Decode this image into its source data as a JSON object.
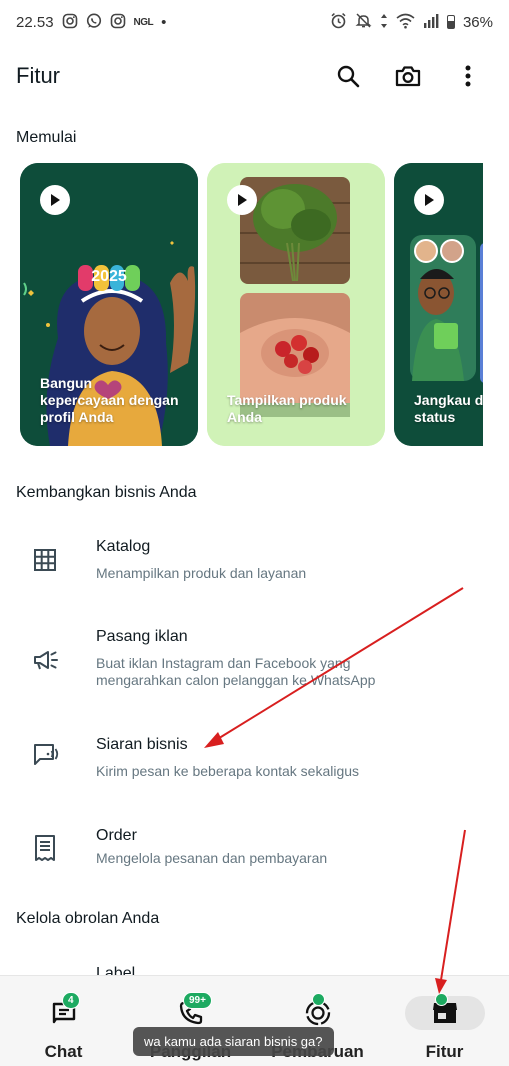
{
  "status_bar": {
    "time": "22.53",
    "ngl_label": "NGL",
    "dot": "•",
    "battery": "36%",
    "left_icons": [
      "instagram-icon",
      "whatsapp-icon",
      "instagram-icon",
      "ngl-icon",
      "dot-icon"
    ],
    "right_icons": [
      "alarm-icon",
      "mute-icon",
      "data-arrows-icon",
      "wifi-icon",
      "signal-icon",
      "battery-icon"
    ]
  },
  "header": {
    "title": "Fitur",
    "actions": [
      "search-icon",
      "camera-icon",
      "more-vert-icon"
    ]
  },
  "getting_started": {
    "title": "Memulai",
    "cards": [
      {
        "caption": "Bangun kepercayaan dengan profil Anda",
        "badge_text": "2025"
      },
      {
        "caption": "Tampilkan produk Anda"
      },
      {
        "caption": "Jangkau d status"
      }
    ]
  },
  "grow_business": {
    "title": "Kembangkan bisnis Anda",
    "items": [
      {
        "title": "Katalog",
        "subtitle": "Menampilkan produk dan layanan",
        "icon": "catalog-grid-icon"
      },
      {
        "title": "Pasang iklan",
        "subtitle": "Buat iklan Instagram dan Facebook yang mengarahkan calon pelanggan ke WhatsApp",
        "icon": "megaphone-icon"
      },
      {
        "title": "Siaran bisnis",
        "subtitle": "Kirim pesan ke beberapa kontak sekaligus",
        "icon": "broadcast-chat-icon"
      },
      {
        "title": "Order",
        "subtitle": "Mengelola pesanan dan pembayaran",
        "icon": "order-receipt-icon"
      }
    ]
  },
  "manage_chats": {
    "title": "Kelola obrolan Anda",
    "partial_item": "Label"
  },
  "bottom_nav": {
    "items": [
      {
        "label": "Chat",
        "icon": "chat-icon",
        "badge": "4"
      },
      {
        "label": "Panggilan",
        "icon": "phone-icon",
        "badge": "99+"
      },
      {
        "label": "Pembaruan",
        "icon": "updates-icon",
        "badge": ""
      },
      {
        "label": "Fitur",
        "icon": "store-icon",
        "badge": "",
        "active": true
      }
    ]
  },
  "toast": {
    "text": "wa kamu ada siaran bisnis ga?"
  },
  "colors": {
    "accent_green": "#1daa61",
    "card_dark_green": "#0e4d3a",
    "card_light_green": "#d0f2b7",
    "annotation_red": "#d81f1f"
  }
}
